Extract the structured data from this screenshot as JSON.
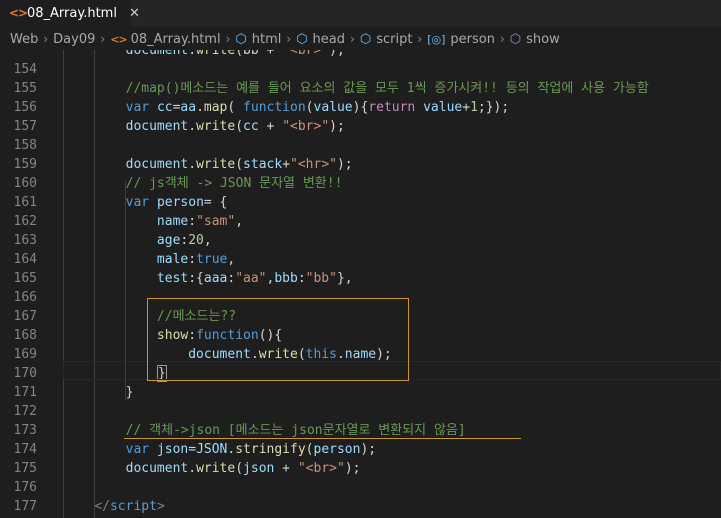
{
  "tab": {
    "icon": "<>",
    "label": "08_Array.html",
    "close": "✕"
  },
  "breadcrumb": [
    "Web",
    "Day09",
    "08_Array.html",
    "html",
    "head",
    "script",
    "person",
    "show"
  ],
  "lines": [
    {
      "num": "",
      "tokens": [
        [
          "o",
          "        "
        ],
        [
          "v",
          "document"
        ],
        [
          "o",
          "."
        ],
        [
          "f",
          "write"
        ],
        [
          "o",
          "(bb + "
        ],
        [
          "s",
          "\"<br>\""
        ],
        [
          "o",
          ");"
        ]
      ]
    },
    {
      "num": "154",
      "tokens": []
    },
    {
      "num": "155",
      "tokens": [
        [
          "o",
          "        "
        ],
        [
          "c",
          "//map()메소드는 예를 들어 요소의 값을 모두 1씩 증가시켜!! 등의 작업에 사용 가능함"
        ]
      ]
    },
    {
      "num": "156",
      "tokens": [
        [
          "o",
          "        "
        ],
        [
          "k",
          "var"
        ],
        [
          "o",
          " "
        ],
        [
          "v",
          "cc"
        ],
        [
          "o",
          "="
        ],
        [
          "v",
          "aa"
        ],
        [
          "o",
          "."
        ],
        [
          "f",
          "map"
        ],
        [
          "o",
          "( "
        ],
        [
          "k",
          "function"
        ],
        [
          "o",
          "("
        ],
        [
          "v",
          "value"
        ],
        [
          "o",
          "){"
        ],
        [
          "kw",
          "return"
        ],
        [
          "o",
          " "
        ],
        [
          "v",
          "value"
        ],
        [
          "o",
          "+"
        ],
        [
          "n",
          "1"
        ],
        [
          "o",
          ";});"
        ]
      ]
    },
    {
      "num": "157",
      "tokens": [
        [
          "o",
          "        "
        ],
        [
          "v",
          "document"
        ],
        [
          "o",
          "."
        ],
        [
          "f",
          "write"
        ],
        [
          "o",
          "("
        ],
        [
          "v",
          "cc"
        ],
        [
          "o",
          " + "
        ],
        [
          "s",
          "\"<br>\""
        ],
        [
          "o",
          ");"
        ]
      ]
    },
    {
      "num": "158",
      "tokens": []
    },
    {
      "num": "159",
      "tokens": [
        [
          "o",
          "        "
        ],
        [
          "v",
          "document"
        ],
        [
          "o",
          "."
        ],
        [
          "f",
          "write"
        ],
        [
          "o",
          "("
        ],
        [
          "v",
          "stack"
        ],
        [
          "o",
          "+"
        ],
        [
          "s",
          "\"<hr>\""
        ],
        [
          "o",
          ");"
        ]
      ]
    },
    {
      "num": "160",
      "tokens": [
        [
          "o",
          "        "
        ],
        [
          "c",
          "// js객체 -> JSON 문자열 변환!!"
        ]
      ]
    },
    {
      "num": "161",
      "tokens": [
        [
          "o",
          "        "
        ],
        [
          "k",
          "var"
        ],
        [
          "o",
          " "
        ],
        [
          "v",
          "person"
        ],
        [
          "o",
          "= {"
        ]
      ]
    },
    {
      "num": "162",
      "tokens": [
        [
          "o",
          "            "
        ],
        [
          "v",
          "name"
        ],
        [
          "o",
          ":"
        ],
        [
          "s",
          "\"sam\""
        ],
        [
          "o",
          ","
        ]
      ]
    },
    {
      "num": "163",
      "tokens": [
        [
          "o",
          "            "
        ],
        [
          "v",
          "age"
        ],
        [
          "o",
          ":"
        ],
        [
          "n",
          "20"
        ],
        [
          "o",
          ","
        ]
      ]
    },
    {
      "num": "164",
      "tokens": [
        [
          "o",
          "            "
        ],
        [
          "v",
          "male"
        ],
        [
          "o",
          ":"
        ],
        [
          "k",
          "true"
        ],
        [
          "o",
          ","
        ]
      ]
    },
    {
      "num": "165",
      "tokens": [
        [
          "o",
          "            "
        ],
        [
          "v",
          "test"
        ],
        [
          "o",
          ":{"
        ],
        [
          "v",
          "aaa"
        ],
        [
          "o",
          ":"
        ],
        [
          "s",
          "\"aa\""
        ],
        [
          "o",
          ","
        ],
        [
          "v",
          "bbb"
        ],
        [
          "o",
          ":"
        ],
        [
          "s",
          "\"bb\""
        ],
        [
          "o",
          "},"
        ]
      ]
    },
    {
      "num": "166",
      "tokens": []
    },
    {
      "num": "167",
      "tokens": [
        [
          "o",
          "            "
        ],
        [
          "c",
          "//메소드는??"
        ]
      ]
    },
    {
      "num": "168",
      "tokens": [
        [
          "o",
          "            "
        ],
        [
          "f",
          "show"
        ],
        [
          "o",
          ":"
        ],
        [
          "k",
          "function"
        ],
        [
          "o",
          "(){"
        ]
      ]
    },
    {
      "num": "169",
      "tokens": [
        [
          "o",
          "                "
        ],
        [
          "v",
          "document"
        ],
        [
          "o",
          "."
        ],
        [
          "f",
          "write"
        ],
        [
          "o",
          "("
        ],
        [
          "k",
          "this"
        ],
        [
          "o",
          "."
        ],
        [
          "v",
          "name"
        ],
        [
          "o",
          ");"
        ]
      ]
    },
    {
      "num": "170",
      "tokens": [
        [
          "o",
          "            "
        ],
        [
          "caret",
          "}"
        ]
      ]
    },
    {
      "num": "171",
      "tokens": [
        [
          "o",
          "        }"
        ]
      ]
    },
    {
      "num": "172",
      "tokens": []
    },
    {
      "num": "173",
      "tokens": [
        [
          "o",
          "        "
        ],
        [
          "c",
          "// 객체->json [메소드는 json문자열로 변환되지 않음]"
        ]
      ]
    },
    {
      "num": "174",
      "tokens": [
        [
          "o",
          "        "
        ],
        [
          "k",
          "var"
        ],
        [
          "o",
          " "
        ],
        [
          "v",
          "json"
        ],
        [
          "o",
          "="
        ],
        [
          "v",
          "JSON"
        ],
        [
          "o",
          "."
        ],
        [
          "f",
          "stringify"
        ],
        [
          "o",
          "("
        ],
        [
          "v",
          "person"
        ],
        [
          "o",
          ");"
        ]
      ]
    },
    {
      "num": "175",
      "tokens": [
        [
          "o",
          "        "
        ],
        [
          "v",
          "document"
        ],
        [
          "o",
          "."
        ],
        [
          "f",
          "write"
        ],
        [
          "o",
          "("
        ],
        [
          "v",
          "json"
        ],
        [
          "o",
          " + "
        ],
        [
          "s",
          "\"<br>\""
        ],
        [
          "o",
          ");"
        ]
      ]
    },
    {
      "num": "176",
      "tokens": []
    },
    {
      "num": "177",
      "tokens": [
        [
          "o",
          "    "
        ],
        [
          "t",
          "</"
        ],
        [
          "tn",
          "script"
        ],
        [
          "t",
          ">"
        ]
      ]
    }
  ],
  "colors": {
    "background": "#1e1e1e",
    "highlight_border": "#c8952e"
  }
}
